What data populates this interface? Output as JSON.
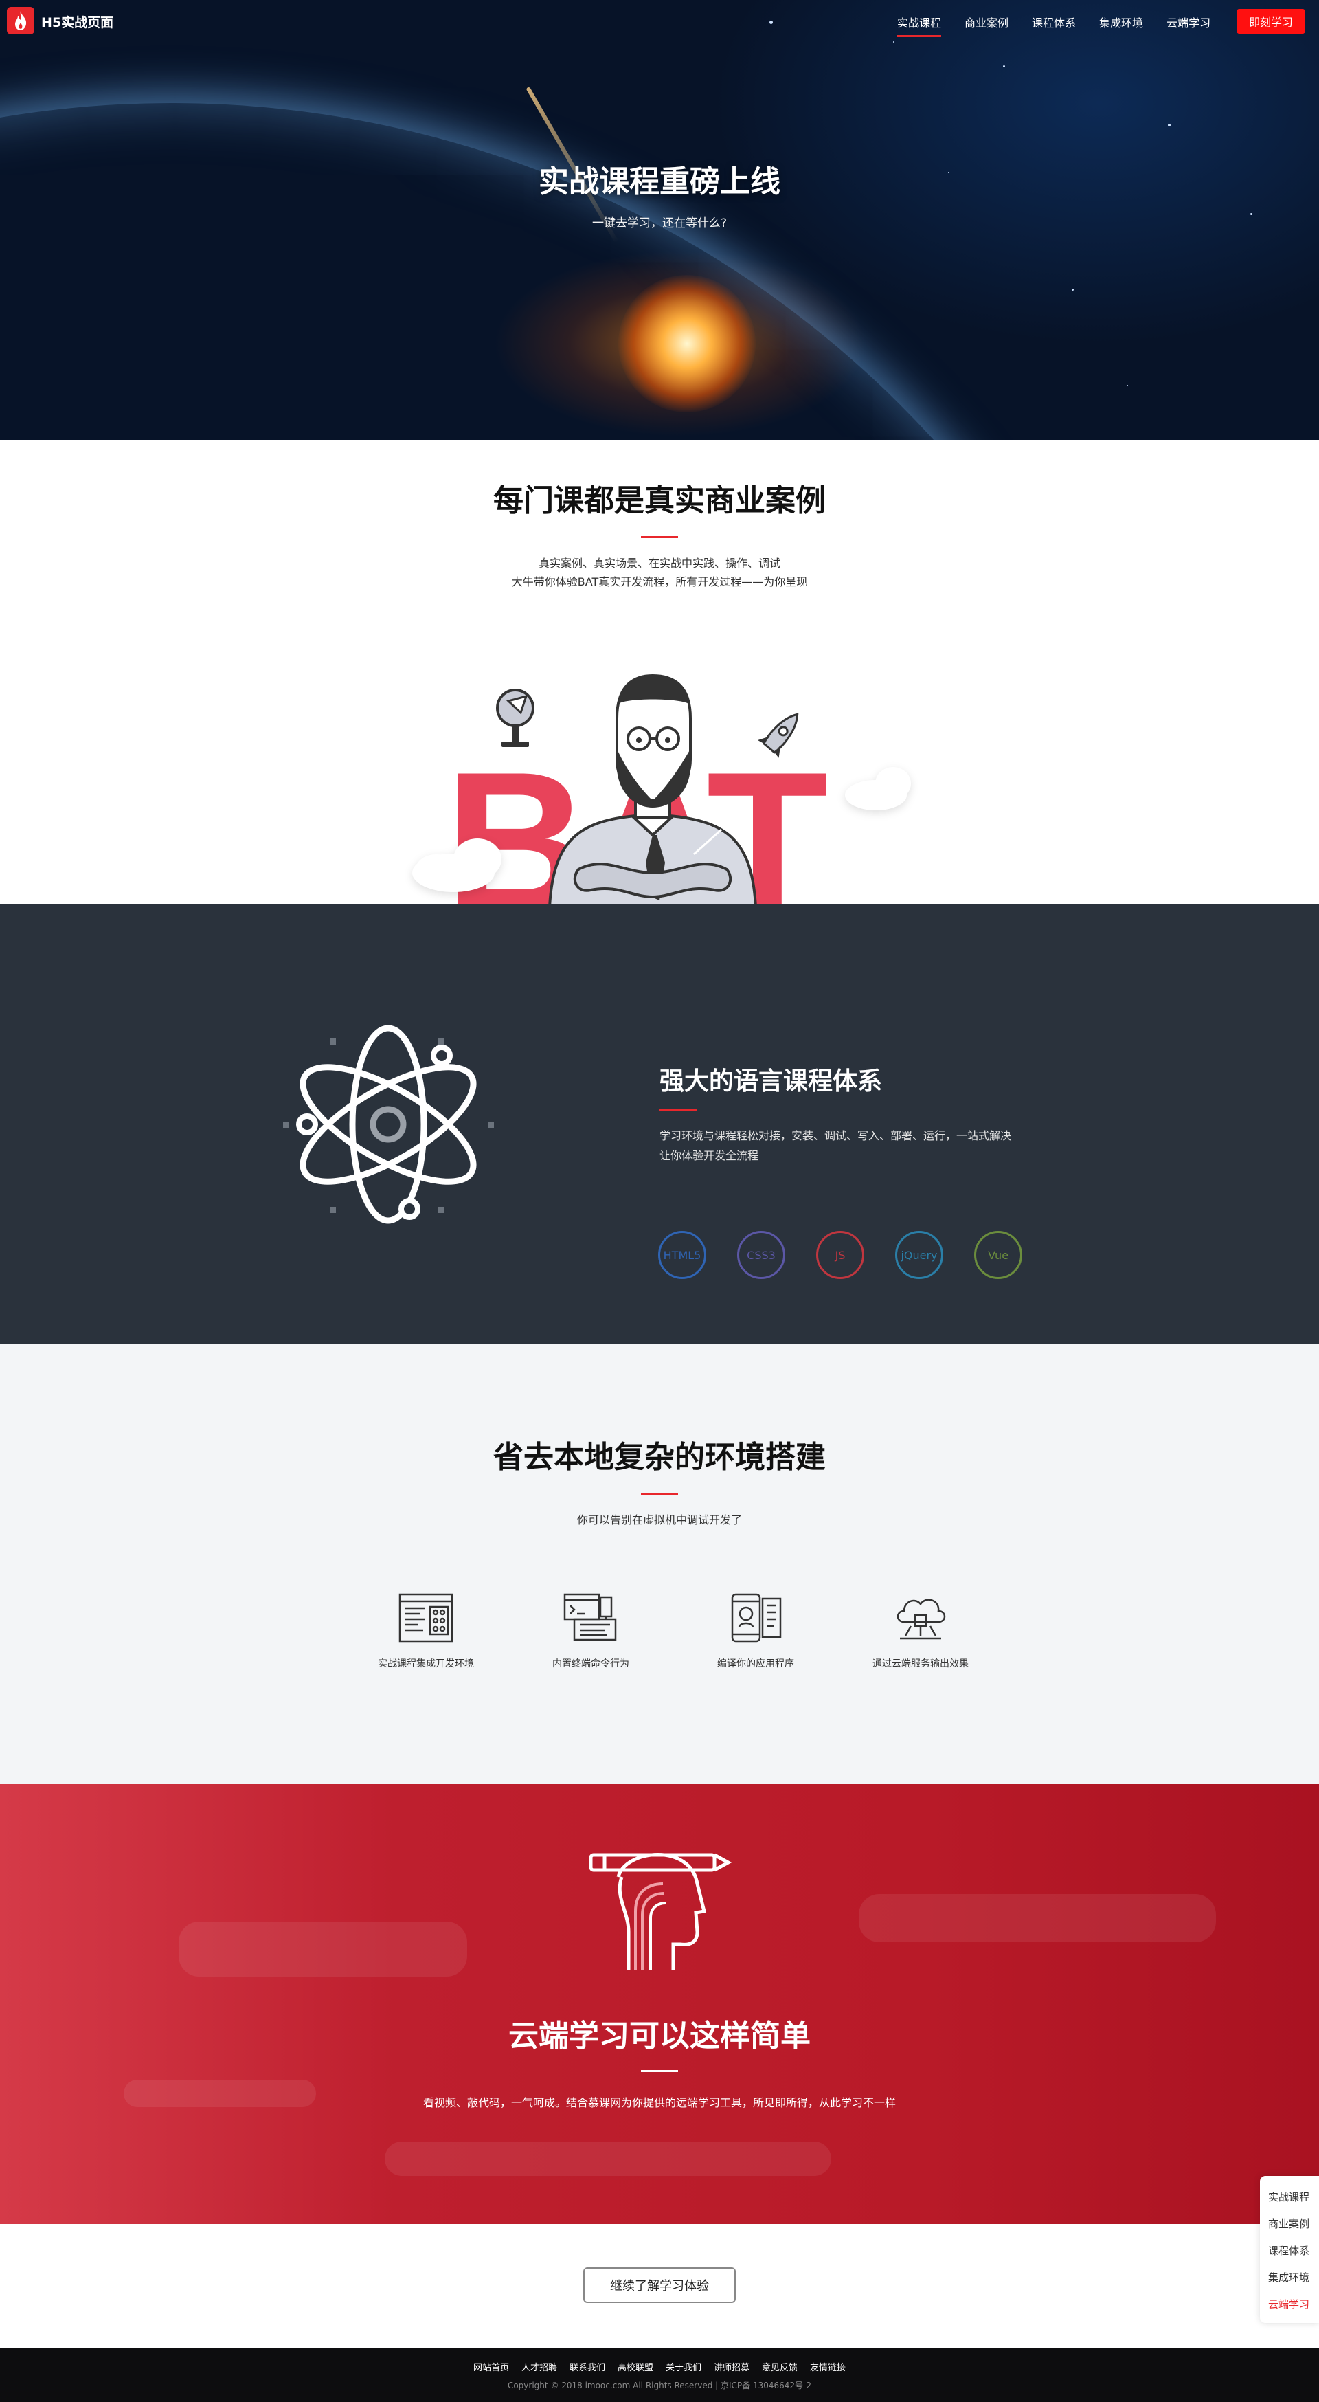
{
  "header": {
    "logo_text": "H5实战页面",
    "nav": [
      {
        "label": "实战课程",
        "active": true
      },
      {
        "label": "商业案例",
        "active": false
      },
      {
        "label": "课程体系",
        "active": false
      },
      {
        "label": "集成环境",
        "active": false
      },
      {
        "label": "云端学习",
        "active": false
      }
    ],
    "cta_label": "即刻学习"
  },
  "hero": {
    "title": "实战课程重磅上线",
    "subtitle": "一键去学习，还在等什么?"
  },
  "cases": {
    "title": "每门课都是真实商业案例",
    "line1": "真实案例、真实场景、在实战中实践、操作、调试",
    "line2": "大牛带你体验BAT真实开发流程，所有开发过程——为你呈现",
    "illustration_text": "BAT"
  },
  "system": {
    "title": "强大的语言课程体系",
    "desc": "学习环境与课程轻松对接，安装、调试、写入、部署、运行，一站式解决让你体验开发全流程",
    "techs": [
      {
        "label": "HTML5",
        "color": "#2f64b4"
      },
      {
        "label": "CSS3",
        "color": "#5b57a6"
      },
      {
        "label": "JS",
        "color": "#c0363f"
      },
      {
        "label": "jQuery",
        "color": "#2a7fa8"
      },
      {
        "label": "Vue",
        "color": "#6b8d3d"
      }
    ]
  },
  "env": {
    "title": "省去本地复杂的环境搭建",
    "subtitle": "你可以告别在虚拟机中调试开发了",
    "features": [
      {
        "icon": "ide-icon",
        "label": "实战课程集成开发环境"
      },
      {
        "icon": "terminal-icon",
        "label": "内置终端命令行为"
      },
      {
        "icon": "mobile-app-icon",
        "label": "编译你的应用程序"
      },
      {
        "icon": "cloud-output-icon",
        "label": "通过云端服务输出效果"
      }
    ]
  },
  "cloud": {
    "title": "云端学习可以这样简单",
    "desc": "看视频、敲代码，一气呵成。结合慕课网为你提供的远端学习工具，所见即所得，从此学习不一样"
  },
  "more_button": "继续了解学习体验",
  "footer": {
    "links": [
      "网站首页",
      "人才招聘",
      "联系我们",
      "高校联盟",
      "关于我们",
      "讲师招募",
      "意见反馈",
      "友情链接"
    ],
    "copyright": "Copyright © 2018 imooc.com All Rights Reserved | 京ICP备 13046642号-2"
  },
  "side_nav": [
    {
      "label": "实战课程",
      "active": false
    },
    {
      "label": "商业案例",
      "active": false
    },
    {
      "label": "课程体系",
      "active": false
    },
    {
      "label": "集成环境",
      "active": false
    },
    {
      "label": "云端学习",
      "active": true
    }
  ],
  "colors": {
    "brand_red": "#e8272c",
    "dark_bg": "#2a323c",
    "light_bg": "#f3f5f7",
    "cloud_red": "#be1f2e"
  }
}
